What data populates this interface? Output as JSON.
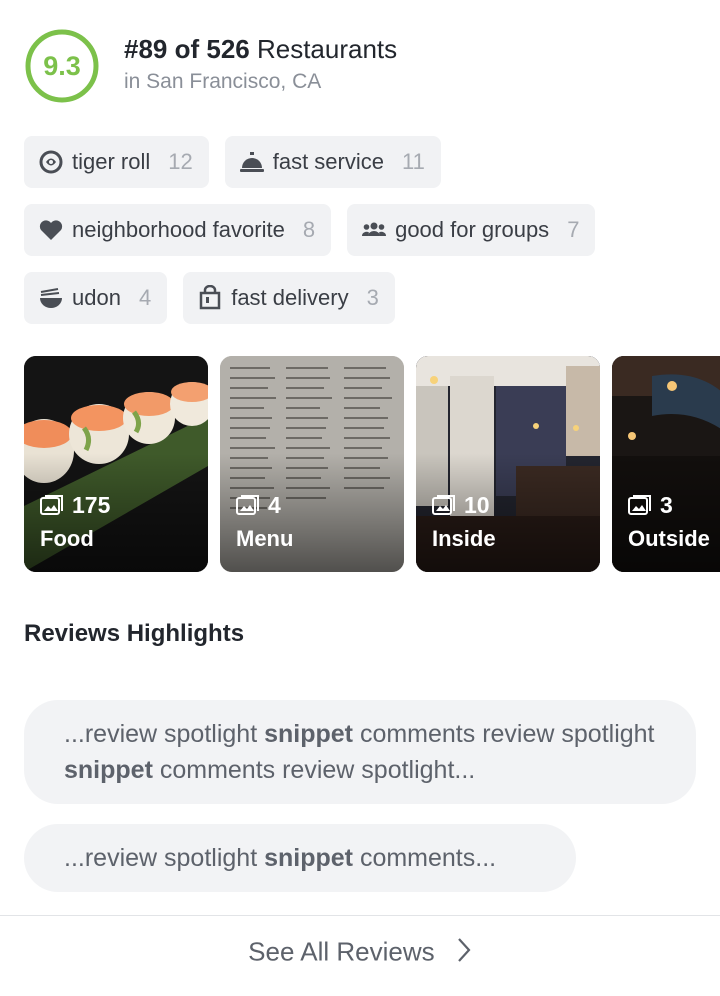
{
  "header": {
    "score": "9.3",
    "rank_bold": "#89 of 526",
    "rank_rest": " Restaurants",
    "location": "in San Francisco, CA",
    "accent_color": "#7cc14a"
  },
  "tags": [
    {
      "icon": "sushi-icon",
      "label": "tiger roll",
      "count": "12"
    },
    {
      "icon": "service-bell-icon",
      "label": "fast service",
      "count": "11"
    },
    {
      "icon": "heart-icon",
      "label": "neighborhood favorite",
      "count": "8"
    },
    {
      "icon": "group-icon",
      "label": "good for groups",
      "count": "7"
    },
    {
      "icon": "noodle-bowl-icon",
      "label": "udon",
      "count": "4"
    },
    {
      "icon": "shopping-bag-icon",
      "label": "fast delivery",
      "count": "3"
    }
  ],
  "photos": [
    {
      "count": "175",
      "label": "Food"
    },
    {
      "count": "4",
      "label": "Menu"
    },
    {
      "count": "10",
      "label": "Inside"
    },
    {
      "count": "3",
      "label": "Outside"
    }
  ],
  "reviews": {
    "title": "Reviews Highlights",
    "snippet1": {
      "a": "...review spotlight ",
      "b": "snippet",
      "c": " comments review spotlight ",
      "d": "snippet",
      "e": " comments review spotlight..."
    },
    "snippet2": {
      "a": "...review spotlight ",
      "b": "snippet",
      "c": " comments..."
    }
  },
  "footer": {
    "see_all": "See All Reviews"
  }
}
